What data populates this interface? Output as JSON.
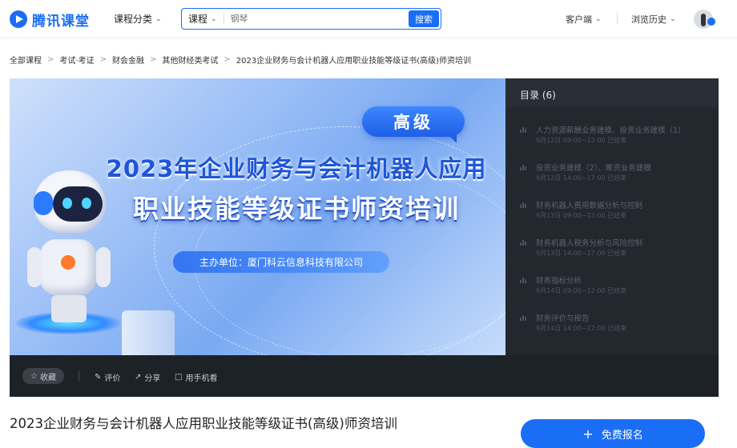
{
  "header": {
    "logo_text": "腾讯课堂",
    "category_label": "课程分类",
    "search": {
      "scope_label": "课程",
      "placeholder": "钢琴",
      "button_label": "搜索"
    },
    "client_label": "客户端",
    "history_label": "浏览历史"
  },
  "breadcrumb": [
    "全部课程",
    "考试·考证",
    "财会金融",
    "其他财经类考试",
    "2023企业财务与会计机器人应用职业技能等级证书(高级)师资培训"
  ],
  "video": {
    "level_tag": "高级",
    "title_line1": "2023年企业财务与会计机器人应用",
    "title_line2": "职业技能等级证书师资培训",
    "host_text": "主办单位：厦门科云信息科技有限公司"
  },
  "catalog": {
    "title": "目录 (6)",
    "chapters": [
      {
        "name": "人力资源薪酬业务建模、投资业务建模（1）",
        "time": "9月12日 09:00~12:00 已结束"
      },
      {
        "name": "投资业务建模（2）、筹资业务建模",
        "time": "9月12日 14:00~17:00 已结束"
      },
      {
        "name": "财务机器人费用数据分析与控制",
        "time": "9月13日 09:00~12:00 已结束"
      },
      {
        "name": "财务机器人税务分析与风险控制",
        "time": "9月13日 14:00~17:00 已结束"
      },
      {
        "name": "财务指标分析",
        "time": "9月14日 09:00~12:00 已结束"
      },
      {
        "name": "财务评价与报告",
        "time": "9月14日 14:00~17:00 已结束"
      }
    ]
  },
  "controls": {
    "favorite_label": "收藏",
    "review_label": "评价",
    "share_label": "分享",
    "mobile_label": "用手机看"
  },
  "course": {
    "title": "2023企业财务与会计机器人应用职业技能等级证书(高级)师资培训",
    "enroll_label": "免费报名"
  },
  "colors": {
    "brand": "#1a6ef5",
    "sidebar_bg": "#22282e"
  }
}
